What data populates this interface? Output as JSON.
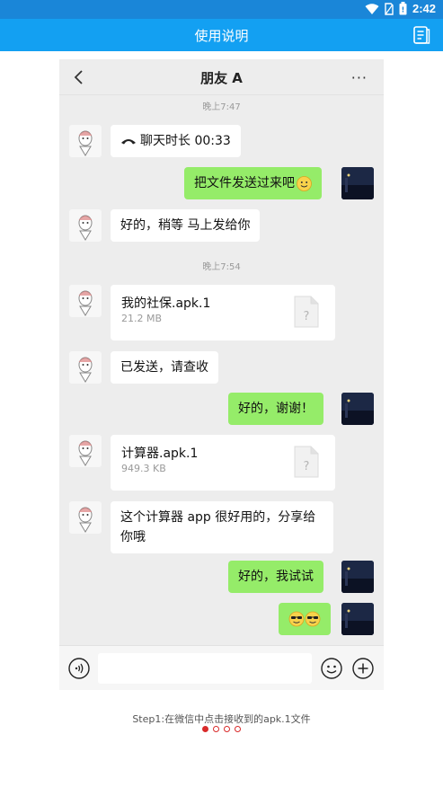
{
  "status_bar": {
    "time": "2:42",
    "icons": [
      "wifi-icon",
      "sim-icon",
      "battery-icon"
    ]
  },
  "app_bar": {
    "title": "使用说明",
    "action_icon": "document-icon"
  },
  "chat": {
    "title": "朋友 A",
    "back_icon": "back-arrow-icon",
    "more_icon": "more-dots-icon",
    "more_label": "···",
    "timestamps": [
      "晚上7:47",
      "晚上7:54"
    ],
    "messages": [
      {
        "from": "friend",
        "text": "聊天时长 00:33",
        "icon": "phone-call-icon"
      },
      {
        "from": "me",
        "text": "把文件发送过来吧",
        "emoji": "smile-emoji"
      },
      {
        "from": "friend",
        "text": "好的，稍等 马上发给你"
      },
      {
        "from": "friend",
        "type": "file",
        "name": "我的社保.apk.1",
        "size": "21.2 MB",
        "icon": "unknown-file-icon"
      },
      {
        "from": "friend",
        "text": "已发送，请查收"
      },
      {
        "from": "me",
        "text": "好的，谢谢！"
      },
      {
        "from": "friend",
        "type": "file",
        "name": "计算器.apk.1",
        "size": "949.3 KB",
        "icon": "unknown-file-icon"
      },
      {
        "from": "friend",
        "text": "这个计算器 app 很好用的，分享给你哦"
      },
      {
        "from": "me",
        "text": "好的，我试试"
      },
      {
        "from": "me",
        "emoji": "sunglasses-emoji-x2"
      }
    ]
  },
  "input_bar": {
    "voice_icon": "voice-icon",
    "emoji_icon": "emoji-icon",
    "plus_icon": "plus-icon",
    "placeholder": ""
  },
  "caption": "Step1:在微信中点击接收到的apk.1文件",
  "pager": {
    "total": 4,
    "active": 1
  },
  "colors": {
    "app_bar": "#13a0f2",
    "status_bar": "#1a86d8",
    "outgoing_bubble": "#95ec69",
    "chat_bg": "#ededed",
    "pager_dot": "#d92a2a"
  }
}
